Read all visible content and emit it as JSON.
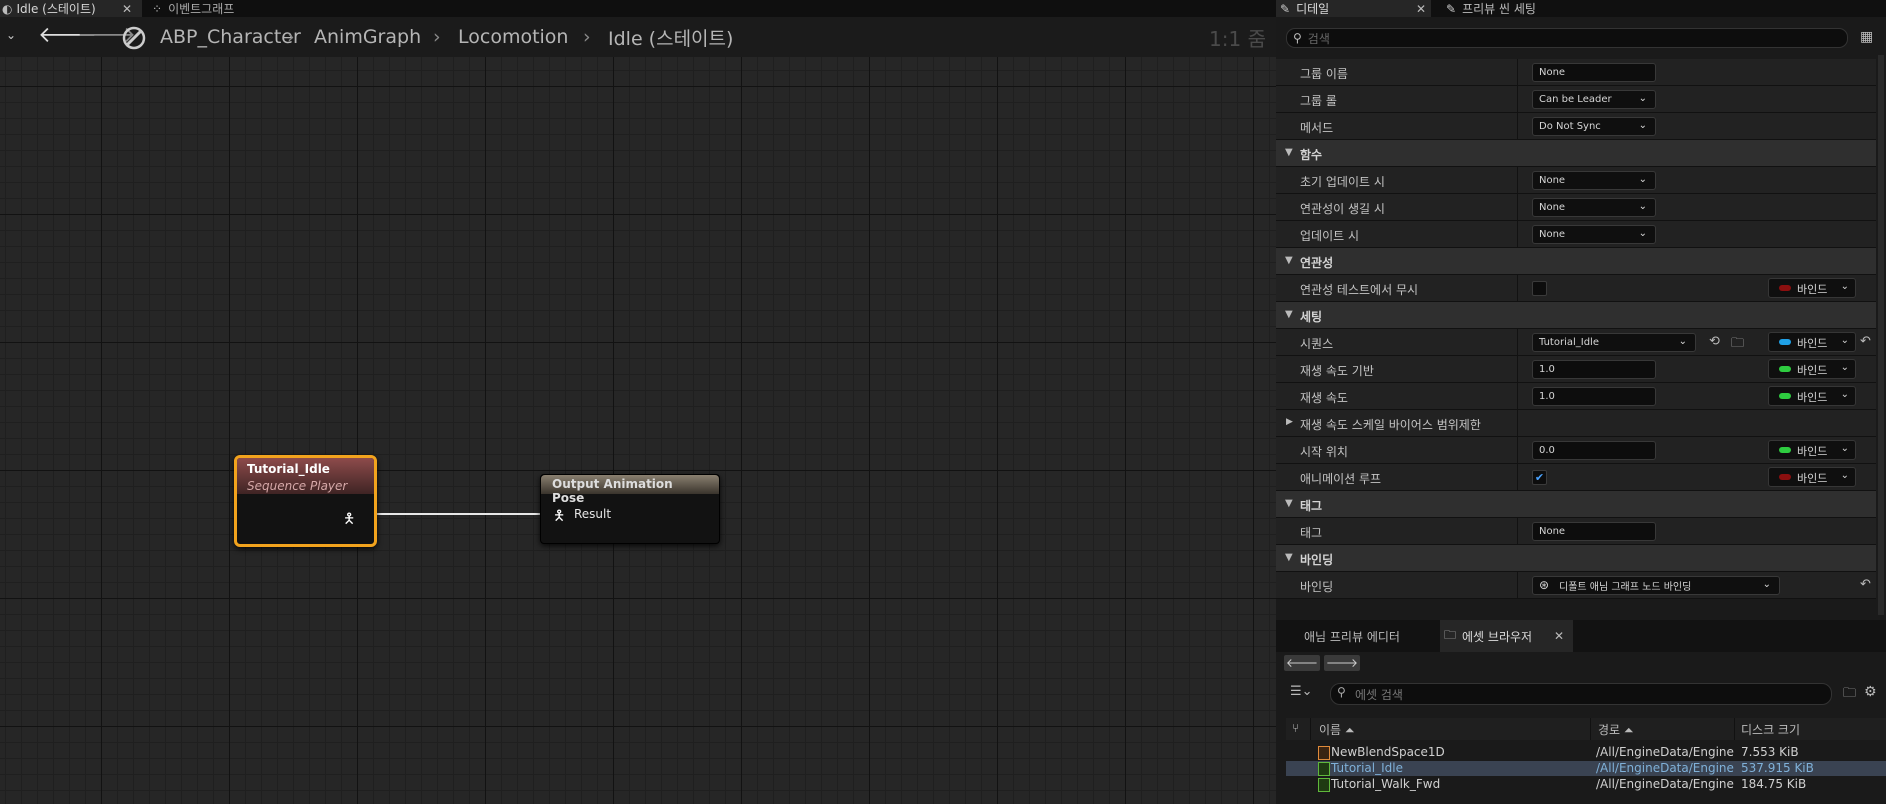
{
  "graph": {
    "tabs": {
      "active_label": "Idle (스테이트)",
      "close": "✕",
      "event_label": "이벤트그래프"
    },
    "nav": {
      "back": "🡐",
      "forward": "🡒"
    },
    "breadcrumb": [
      "ABP_Character",
      "AnimGraph",
      "Locomotion",
      "Idle (스테이트)"
    ],
    "zoom": "1:1 줌",
    "nodes": {
      "seq": {
        "title": "Tutorial_Idle",
        "subtitle": "Sequence Player"
      },
      "out": {
        "title": "Output Animation Pose",
        "pin": "Result"
      }
    }
  },
  "details": {
    "tabs": {
      "details": "디테일",
      "close": "✕",
      "preview": "프리뷰 씬 세팅"
    },
    "search_placeholder": "검색",
    "rows": {
      "group_name": {
        "label": "그룹 이름",
        "value": "None"
      },
      "group_role": {
        "label": "그룹 롤",
        "value": "Can be Leader"
      },
      "method": {
        "label": "메서드",
        "value": "Do Not Sync"
      },
      "cat_func": "함수",
      "init_update": {
        "label": "초기 업데이트 시",
        "value": "None"
      },
      "become_relevant": {
        "label": "연관성이 생길 시",
        "value": "None"
      },
      "on_update": {
        "label": "업데이트 시",
        "value": "None"
      },
      "cat_relevancy": "연관성",
      "ignore_relevancy": {
        "label": "연관성 테스트에서 무시",
        "bind": "바인드"
      },
      "cat_settings": "세팅",
      "sequence": {
        "label": "시퀀스",
        "value": "Tutorial_Idle",
        "bind": "바인드"
      },
      "play_rate_basis": {
        "label": "재생 속도 기반",
        "value": "1.0",
        "bind": "바인드"
      },
      "play_rate": {
        "label": "재생 속도",
        "value": "1.0",
        "bind": "바인드"
      },
      "play_rate_scale": {
        "label": "재생 속도 스케일 바이어스 범위제한"
      },
      "start_position": {
        "label": "시작 위치",
        "value": "0.0",
        "bind": "바인드"
      },
      "loop": {
        "label": "애니메이션 루프",
        "bind": "바인드"
      },
      "cat_tag": "태그",
      "tag": {
        "label": "태그",
        "value": "None"
      },
      "cat_binding": "바인딩",
      "binding": {
        "label": "바인딩",
        "value": "디폴트 애님 그래프 노드 바인딩"
      }
    },
    "colors": {
      "bind_red": "#8b0f0f",
      "bind_blue": "#1fa0e6",
      "bind_green": "#2ecc40",
      "checkbox_blue": "#4aa3ff"
    }
  },
  "content_browser": {
    "tabs": {
      "preview": "애님 프리뷰 에디터",
      "assets": "에셋 브라우저",
      "close": "✕"
    },
    "search_placeholder": "에셋 검색",
    "columns": {
      "name": "이름 ⏶",
      "path": "경로 ⏶",
      "size": "디스크 크기"
    },
    "assets": [
      {
        "name": "NewBlendSpace1D",
        "path": "/All/EngineData/Engine",
        "size": "7.553 KiB",
        "color": "#e08a3a"
      },
      {
        "name": "Tutorial_Idle",
        "path": "/All/EngineData/Engine",
        "size": "537.915 KiB",
        "color": "#5fb83b"
      },
      {
        "name": "Tutorial_Walk_Fwd",
        "path": "/All/EngineData/Engine",
        "size": "184.75 KiB",
        "color": "#5fb83b"
      }
    ]
  }
}
